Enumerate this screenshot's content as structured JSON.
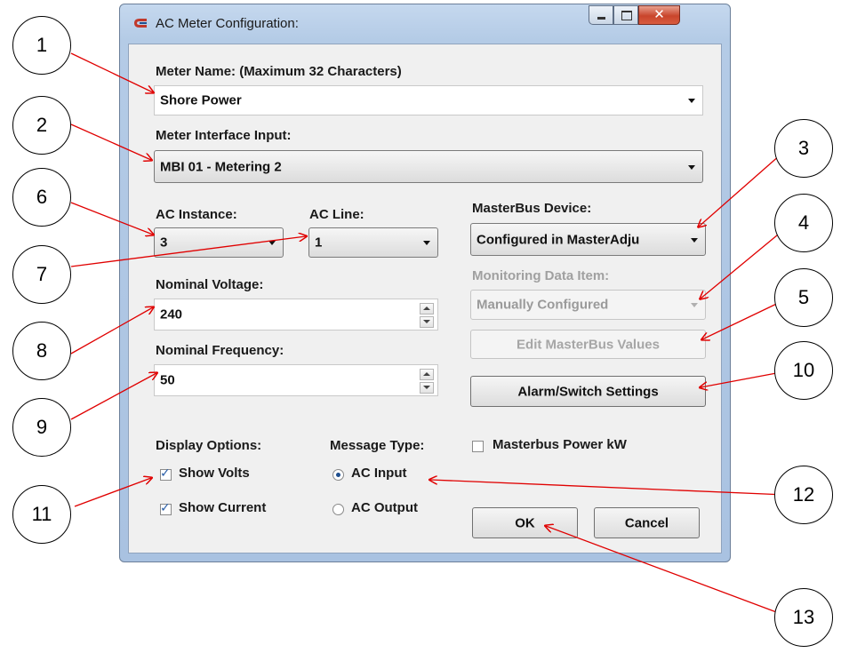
{
  "window": {
    "title": "AC Meter Configuration:",
    "icon": "app-logo-icon"
  },
  "meter_name": {
    "label": "Meter Name: (Maximum 32 Characters)",
    "value": "Shore Power"
  },
  "meter_interface": {
    "label": "Meter Interface Input:",
    "value": "MBI 01 - Metering 2"
  },
  "ac_instance": {
    "label": "AC Instance:",
    "value": "3"
  },
  "ac_line": {
    "label": "AC Line:",
    "value": "1"
  },
  "nominal_voltage": {
    "label": "Nominal Voltage:",
    "value": "240"
  },
  "nominal_frequency": {
    "label": "Nominal Frequency:",
    "value": "50"
  },
  "masterbus_device": {
    "label": "MasterBus Device:",
    "value": "Configured in MasterAdju"
  },
  "monitoring_item": {
    "label": "Monitoring Data Item:",
    "value": "Manually Configured"
  },
  "buttons": {
    "edit_masterbus": "Edit MasterBus Values",
    "alarm_switch": "Alarm/Switch Settings",
    "ok": "OK",
    "cancel": "Cancel"
  },
  "display_options": {
    "label": "Display Options:",
    "show_volts": {
      "label": "Show Volts",
      "checked": true
    },
    "show_current": {
      "label": "Show Current",
      "checked": true
    }
  },
  "message_type": {
    "label": "Message Type:",
    "ac_input": {
      "label": "AC Input",
      "selected": true
    },
    "ac_output": {
      "label": "AC Output",
      "selected": false
    }
  },
  "masterbus_power_kw": {
    "label": "Masterbus Power kW",
    "checked": false
  },
  "callouts": [
    "1",
    "2",
    "3",
    "4",
    "5",
    "6",
    "7",
    "8",
    "9",
    "10",
    "11",
    "12",
    "13"
  ],
  "colors": {
    "arrow": "#e00000",
    "window_frame": "#b4cbe6",
    "client_bg": "#f0f0f0"
  }
}
